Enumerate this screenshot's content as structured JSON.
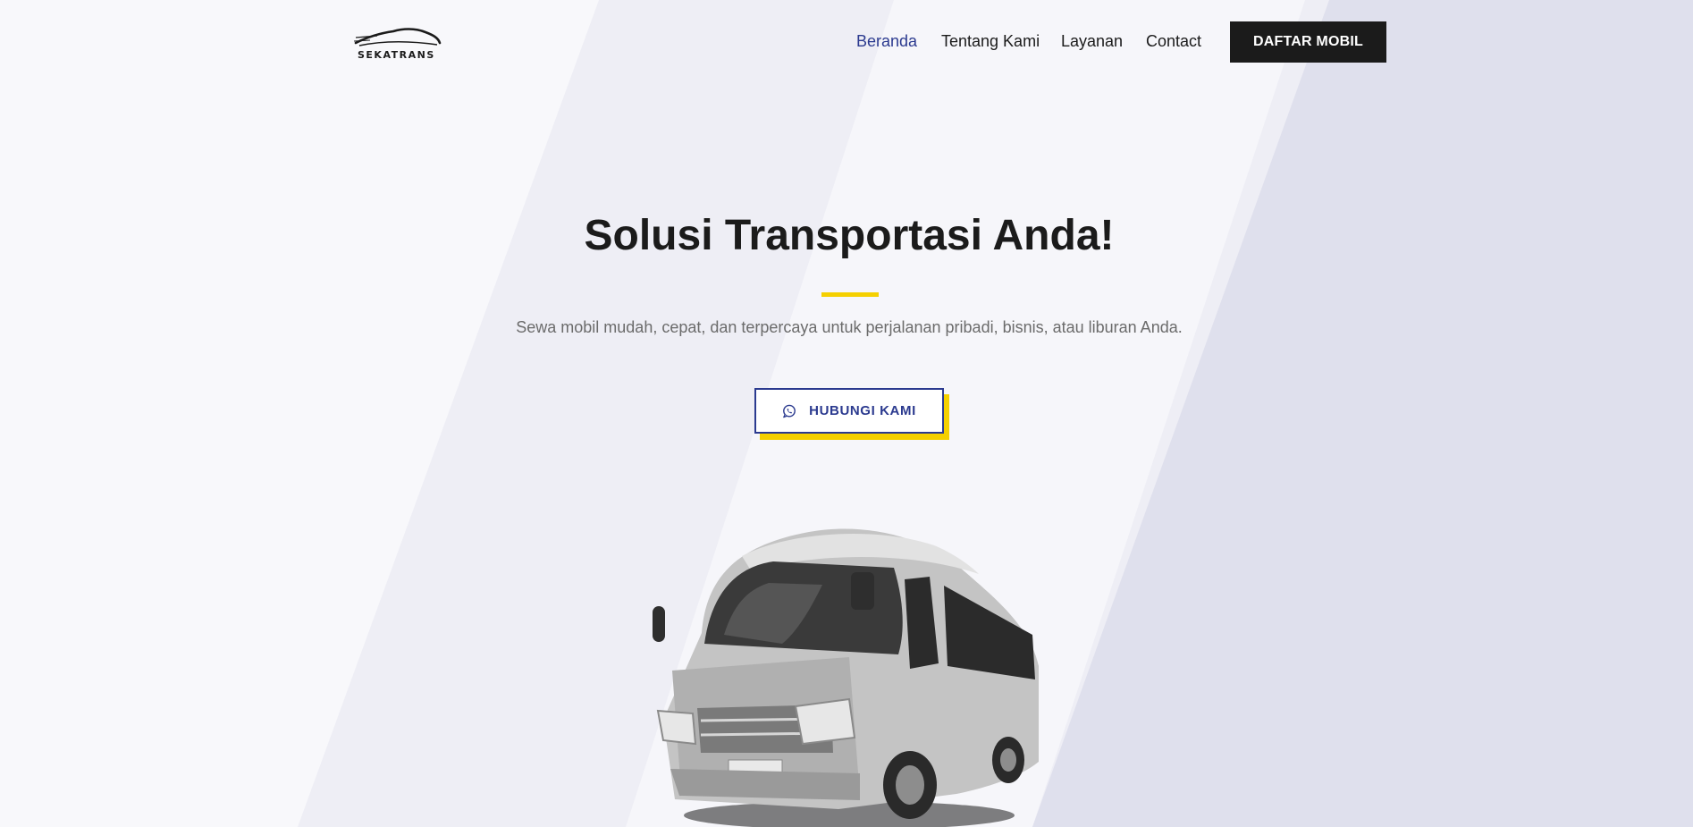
{
  "brand": {
    "name": "SEKATRANS",
    "logo_icon": "car-silhouette-icon"
  },
  "nav": {
    "items": [
      {
        "label": "Beranda",
        "active": true
      },
      {
        "label": "Tentang Kami",
        "active": false
      },
      {
        "label": "Layanan",
        "active": false
      },
      {
        "label": "Contact",
        "active": false
      }
    ],
    "cta_label": "DAFTAR MOBIL"
  },
  "hero": {
    "title": "Solusi Transportasi Anda!",
    "subtitle": "Sewa mobil mudah, cepat, dan terpercaya untuk perjalanan pribadi, bisnis, atau liburan Anda.",
    "button_label": "HUBUNGI KAMI",
    "button_icon": "whatsapp-icon",
    "image": "white-minibus-van"
  },
  "colors": {
    "accent_blue": "#2b3a8f",
    "accent_yellow": "#f5d000",
    "dark": "#1b1b1b",
    "text_muted": "#6b6b6b"
  }
}
